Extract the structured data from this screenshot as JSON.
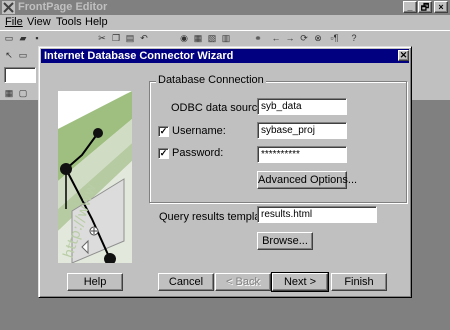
{
  "app": {
    "title": "FrontPage Editor",
    "window_buttons": [
      "_",
      "🗗",
      "×"
    ],
    "menus": [
      "File",
      "View",
      "Tools",
      "Help"
    ]
  },
  "dialog": {
    "title": "Internet Database Connector Wizard",
    "group_label": "Database Connection",
    "odbc_label": "ODBC data source:",
    "odbc_value": "syb_data",
    "username_label": "Username:",
    "username_checked": true,
    "username_value": "sybase_proj",
    "password_label": "Password:",
    "password_checked": true,
    "password_value": "**********",
    "advanced_button": "Advanced Options...",
    "template_label": "Query results template:",
    "template_value": "results.html",
    "browse_button": "Browse...",
    "help_button": "Help",
    "cancel_button": "Cancel",
    "back_button": "< Back",
    "next_button": "Next >",
    "finish_button": "Finish",
    "art_text": "http://www"
  }
}
